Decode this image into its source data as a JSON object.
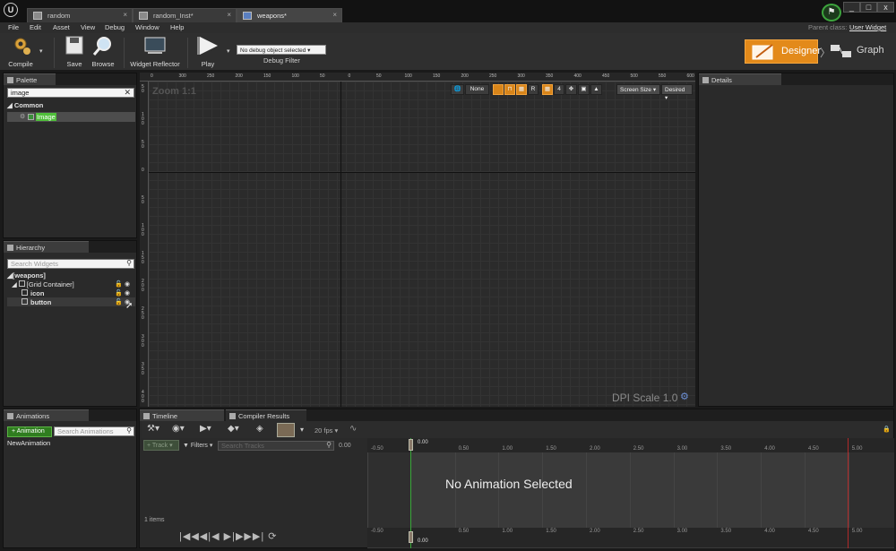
{
  "title_bar": {
    "logo": "U",
    "tabs": [
      {
        "label": "random",
        "icon": "blueprint-icon"
      },
      {
        "label": "random_Inst*",
        "icon": "blueprint-instance-icon"
      },
      {
        "label": "weapons*",
        "icon": "widget-blueprint-icon"
      }
    ],
    "window_buttons": [
      "_",
      "□",
      "x"
    ]
  },
  "menu": [
    "File",
    "Edit",
    "Asset",
    "View",
    "Debug",
    "Window",
    "Help"
  ],
  "parent_class": {
    "label": "Parent class:",
    "value": "User Widget"
  },
  "toolbar": {
    "compile": "Compile",
    "save": "Save",
    "browse": "Browse",
    "widget_reflector": "Widget Reflector",
    "play": "Play",
    "debug_select": "No debug object selected ▾",
    "debug_filter": "Debug Filter",
    "designer": "Designer",
    "graph": "Graph"
  },
  "palette": {
    "tab": "Palette",
    "search_value": "image",
    "category": "Common",
    "items": [
      "Image"
    ]
  },
  "hierarchy": {
    "tab": "Hierarchy",
    "search_placeholder": "Search Widgets",
    "tree": [
      "[weapons]",
      "[Grid Container]",
      "icon",
      "button"
    ]
  },
  "viewport": {
    "zoom": "Zoom 1:1",
    "none_label": "None",
    "r_label": "R",
    "grid_snap": "4",
    "screen_size": "Screen Size ▾",
    "desired": "Desired ▾",
    "dpi": "DPI Scale 1.0",
    "ruler_h": [
      "0",
      "300",
      "250",
      "200",
      "150",
      "100",
      "50",
      "0",
      "50",
      "100",
      "150",
      "200",
      "250",
      "300",
      "350",
      "400",
      "450",
      "500",
      "550",
      "600"
    ],
    "ruler_v": [
      "5 0",
      "1 0 0",
      "5 0",
      "0",
      "5 0",
      "1 0 0",
      "1 5 0",
      "2 0 0",
      "2 5 0",
      "3 0 0",
      "3 5 0",
      "4 0 0"
    ]
  },
  "details": {
    "tab": "Details"
  },
  "animations": {
    "tab": "Animations",
    "add_button": "+ Animation",
    "search_placeholder": "Search Animations",
    "items": [
      "NewAnimation"
    ]
  },
  "timeline": {
    "tabs": [
      "Timeline",
      "Compiler Results"
    ],
    "fps": "20 fps ▾",
    "track_button": "+ Track ▾",
    "filters": "▼ Filters ▾",
    "search_tracks_placeholder": "Search Tracks",
    "current_time": "0.00",
    "items_count": "1 items",
    "no_animation": "No Animation Selected",
    "ruler": [
      "-0.50",
      "0.00",
      "0.50",
      "1.00",
      "1.50",
      "2.00",
      "2.50",
      "3.00",
      "3.50",
      "4.00",
      "4.50",
      "5.00"
    ],
    "playhead_label": "0.00"
  }
}
